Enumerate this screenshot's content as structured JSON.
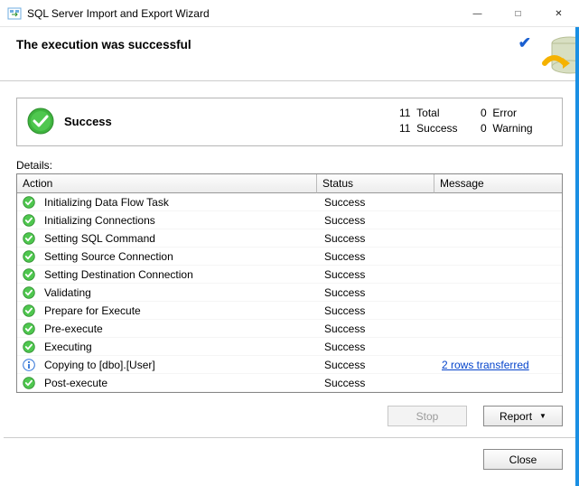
{
  "window": {
    "title": "SQL Server Import and Export Wizard"
  },
  "header": {
    "headline": "The execution was successful"
  },
  "summary": {
    "label": "Success",
    "total_count": "11",
    "total_label": "Total",
    "success_count": "11",
    "success_label": "Success",
    "error_count": "0",
    "error_label": "Error",
    "warning_count": "0",
    "warning_label": "Warning"
  },
  "details_label": "Details:",
  "columns": {
    "action": "Action",
    "status": "Status",
    "message": "Message"
  },
  "rows": [
    {
      "icon": "success",
      "action": "Initializing Data Flow Task",
      "status": "Success",
      "message": ""
    },
    {
      "icon": "success",
      "action": "Initializing Connections",
      "status": "Success",
      "message": ""
    },
    {
      "icon": "success",
      "action": "Setting SQL Command",
      "status": "Success",
      "message": ""
    },
    {
      "icon": "success",
      "action": "Setting Source Connection",
      "status": "Success",
      "message": ""
    },
    {
      "icon": "success",
      "action": "Setting Destination Connection",
      "status": "Success",
      "message": ""
    },
    {
      "icon": "success",
      "action": "Validating",
      "status": "Success",
      "message": ""
    },
    {
      "icon": "success",
      "action": "Prepare for Execute",
      "status": "Success",
      "message": ""
    },
    {
      "icon": "success",
      "action": "Pre-execute",
      "status": "Success",
      "message": ""
    },
    {
      "icon": "success",
      "action": "Executing",
      "status": "Success",
      "message": ""
    },
    {
      "icon": "info",
      "action": "Copying to [dbo].[User]",
      "status": "Success",
      "message": "2 rows transferred",
      "message_link": true
    },
    {
      "icon": "success",
      "action": "Post-execute",
      "status": "Success",
      "message": ""
    }
  ],
  "buttons": {
    "stop": "Stop",
    "report": "Report",
    "close": "Close"
  }
}
